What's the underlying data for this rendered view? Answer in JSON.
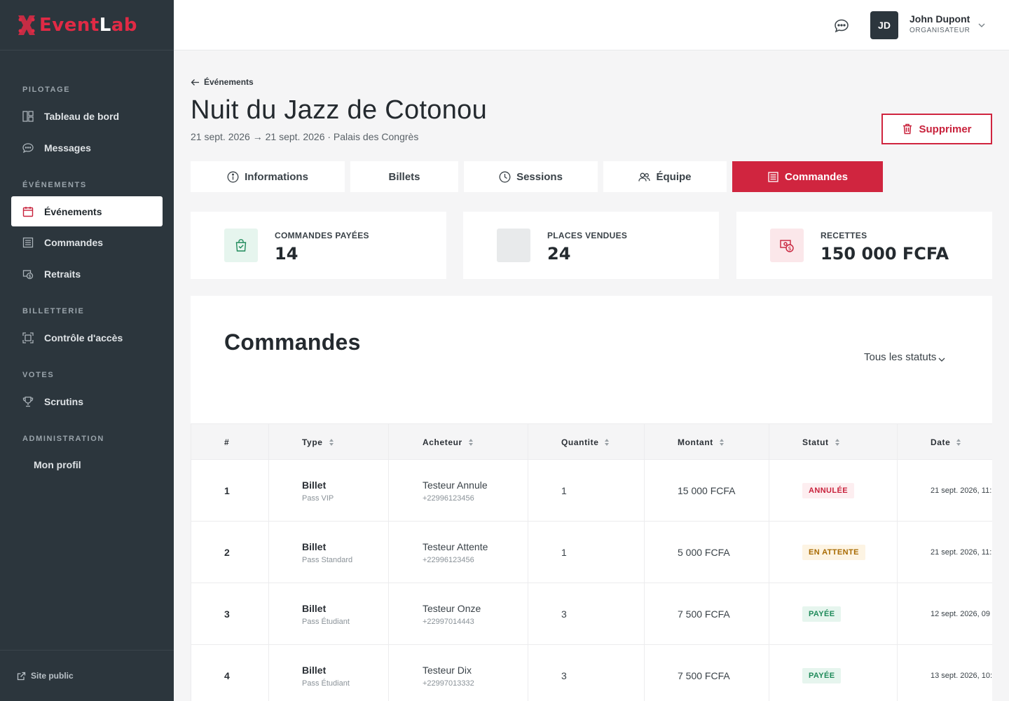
{
  "brand": {
    "part1": "Event",
    "part2": "L",
    "part3": "ab"
  },
  "sidebar": {
    "sections": [
      "PILOTAGE",
      "ÉVÉNEMENTS",
      "BILLETTERIE",
      "VOTES",
      "ADMINISTRATION"
    ],
    "items": [
      {
        "label": "Tableau de bord",
        "icon": "dashboard-icon"
      },
      {
        "label": "Messages",
        "icon": "chat-icon"
      },
      {
        "label": "Événements",
        "icon": "calendar-icon"
      },
      {
        "label": "Commandes",
        "icon": "orders-icon"
      },
      {
        "label": "Retraits",
        "icon": "withdraw-icon"
      },
      {
        "label": "Contrôle d'accès",
        "icon": "scan-icon"
      },
      {
        "label": "Scrutins",
        "icon": "trophy-icon"
      },
      {
        "label": "Mon profil"
      }
    ],
    "footer_link": "Site public"
  },
  "topbar": {
    "avatar_initials": "JD",
    "user_name": "John Dupont",
    "user_role": "ORGANISATEUR"
  },
  "header": {
    "back_label": "Événements",
    "title": "Nuit du Jazz de Cotonou",
    "subtitle": "21 sept. 2026 → 21 sept. 2026 · Palais des Congrès",
    "delete_label": "Supprimer"
  },
  "tabs": [
    {
      "label": "Informations",
      "icon": "info-icon"
    },
    {
      "label": "Billets"
    },
    {
      "label": "Sessions",
      "icon": "clock-icon"
    },
    {
      "label": "Équipe",
      "icon": "team-icon"
    },
    {
      "label": "Commandes",
      "icon": "list-icon",
      "active": true
    }
  ],
  "stats": [
    {
      "label": "COMMANDES PAYÉES",
      "value": "14"
    },
    {
      "label": "PLACES VENDUES",
      "value": "24"
    },
    {
      "label": "RECETTES",
      "value": "150 000 FCFA"
    }
  ],
  "orders": {
    "title": "Commandes",
    "filter_label": "Tous les statuts",
    "columns": [
      "#",
      "Type",
      "Acheteur",
      "Quantite",
      "Montant",
      "Statut",
      "Date"
    ],
    "rows": [
      {
        "num": "1",
        "type": "Billet",
        "type_sub": "Pass VIP",
        "buyer": "Testeur Annule",
        "phone": "+22996123456",
        "qty": "1",
        "amount": "15 000 FCFA",
        "status": "ANNULÉE",
        "date": "21 sept. 2026, 11:"
      },
      {
        "num": "2",
        "type": "Billet",
        "type_sub": "Pass Standard",
        "buyer": "Testeur Attente",
        "phone": "+22996123456",
        "qty": "1",
        "amount": "5 000 FCFA",
        "status": "EN ATTENTE",
        "date": "21 sept. 2026, 11:"
      },
      {
        "num": "3",
        "type": "Billet",
        "type_sub": "Pass Étudiant",
        "buyer": "Testeur Onze",
        "phone": "+22997014443",
        "qty": "3",
        "amount": "7 500 FCFA",
        "status": "PAYÉE",
        "date": "12 sept. 2026, 09"
      },
      {
        "num": "4",
        "type": "Billet",
        "type_sub": "Pass Étudiant",
        "buyer": "Testeur Dix",
        "phone": "+22997013332",
        "qty": "3",
        "amount": "7 500 FCFA",
        "status": "PAYÉE",
        "date": "13 sept. 2026, 10:"
      }
    ]
  },
  "colors": {
    "accent": "#d0253f",
    "sidebar_bg": "#2c363d",
    "status_cancelled": "#c8213b",
    "status_pending": "#a86a00",
    "status_paid": "#1f8a5a"
  }
}
